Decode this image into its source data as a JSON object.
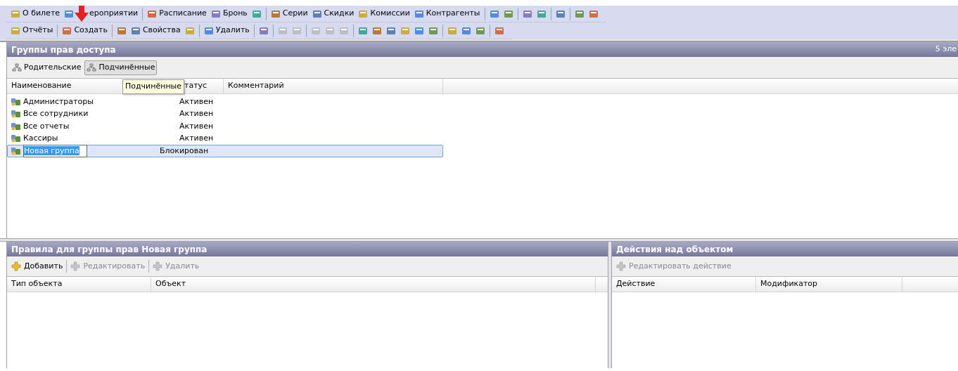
{
  "toolbars": [
    {
      "groups": [
        [
          {
            "label": "О билете",
            "disabled": false
          },
          {
            "label": "ероприятии",
            "disabled": false,
            "marked": true
          }
        ],
        [
          {
            "label": "Расписание",
            "disabled": false
          },
          {
            "label": "Бронь",
            "disabled": false
          },
          {
            "disabled": false
          }
        ],
        [
          {
            "label": "Серии",
            "disabled": false
          },
          {
            "label": "Скидки",
            "disabled": false
          },
          {
            "label": "Комиссии",
            "disabled": false
          },
          {
            "label": "Контрагенты",
            "disabled": false
          }
        ],
        [
          {
            "disabled": false
          },
          {
            "disabled": false
          }
        ],
        [
          {
            "disabled": false
          },
          {
            "disabled": false
          }
        ],
        [
          {
            "disabled": false
          }
        ],
        [
          {
            "disabled": false
          },
          {
            "disabled": false
          }
        ]
      ]
    },
    {
      "groups": [
        [
          {
            "label": "Отчёты",
            "disabled": false
          }
        ],
        [
          {
            "label": "Создать",
            "disabled": false
          }
        ],
        [
          {
            "disabled": false
          },
          {
            "label": "Свойства",
            "disabled": false
          },
          {
            "disabled": false
          }
        ],
        [
          {
            "label": "Удалить",
            "disabled": false
          }
        ],
        [
          {
            "disabled": false
          }
        ],
        [
          {
            "disabled": true
          },
          {
            "disabled": true
          }
        ],
        [
          {
            "disabled": true
          },
          {
            "disabled": true
          },
          {
            "disabled": true
          }
        ],
        [
          {
            "disabled": false
          },
          {
            "disabled": false
          },
          {
            "disabled": false
          },
          {
            "disabled": false
          },
          {
            "disabled": false
          },
          {
            "disabled": false
          }
        ],
        [
          {
            "disabled": false
          },
          {
            "disabled": false
          },
          {
            "disabled": false
          }
        ],
        [
          {
            "disabled": false
          }
        ]
      ]
    }
  ],
  "groups_panel": {
    "title": "Группы прав доступа",
    "count": "5 эле",
    "view_buttons": [
      {
        "label": "Родительские",
        "selected": false
      },
      {
        "label": "Подчинённые",
        "selected": true
      }
    ],
    "tooltip": "Подчинённые",
    "columns": [
      "Наименование",
      "татус",
      "Комментарий"
    ],
    "rows": [
      {
        "name": "Администраторы",
        "status": "Активен",
        "selected": false
      },
      {
        "name": "Все сотрудники",
        "status": "Активен",
        "selected": false
      },
      {
        "name": "Все отчеты",
        "status": "Активен",
        "selected": false
      },
      {
        "name": "Кассиры",
        "status": "Активен",
        "selected": false
      },
      {
        "name": "Новая группа",
        "status": "Блокирован",
        "selected": true
      }
    ]
  },
  "rules_panel": {
    "title": "Правила для группы прав Новая группа",
    "buttons": [
      {
        "label": "Добавить",
        "disabled": false
      },
      {
        "label": "Редактировать",
        "disabled": true
      },
      {
        "label": "Удалить",
        "disabled": true
      }
    ],
    "columns": [
      "Тип объекта",
      "Объект"
    ]
  },
  "actions_panel": {
    "title": "Действия над объектом",
    "buttons": [
      {
        "label": "Редактировать действие",
        "disabled": true
      }
    ],
    "columns": [
      "Действие",
      "Модификатор"
    ]
  }
}
